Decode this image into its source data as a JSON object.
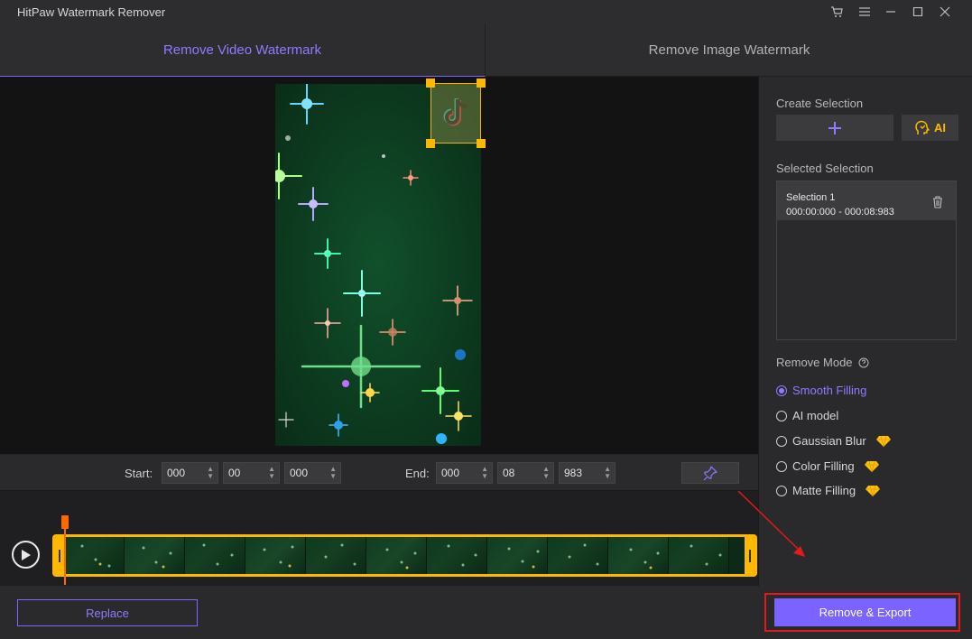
{
  "window": {
    "title": "HitPaw Watermark Remover",
    "controls": [
      "cart-icon",
      "menu-icon",
      "minimize-icon",
      "maximize-icon",
      "close-icon"
    ]
  },
  "tabs": [
    {
      "label": "Remove Video Watermark",
      "active": true
    },
    {
      "label": "Remove Image Watermark",
      "active": false
    }
  ],
  "time": {
    "start_label": "Start:",
    "start": {
      "h": "000",
      "m": "00",
      "s": "000"
    },
    "end_label": "End:",
    "end": {
      "h": "000",
      "m": "08",
      "s": "983"
    }
  },
  "panel": {
    "create_label": "Create Selection",
    "ai_label": "AI",
    "selected_label": "Selected Selection",
    "selections": [
      {
        "name": "Selection 1",
        "range": "000:00:000 - 000:08:983"
      }
    ],
    "mode_label": "Remove Mode",
    "modes": [
      {
        "label": "Smooth Filling",
        "selected": true,
        "premium": false
      },
      {
        "label": "AI model",
        "selected": false,
        "premium": false
      },
      {
        "label": "Gaussian Blur",
        "selected": false,
        "premium": true
      },
      {
        "label": "Color Filling",
        "selected": false,
        "premium": true
      },
      {
        "label": "Matte Filling",
        "selected": false,
        "premium": true
      }
    ]
  },
  "footer": {
    "replace_label": "Replace",
    "export_label": "Remove & Export"
  },
  "colors": {
    "accent": "#7b63ff",
    "highlight": "#ffb800",
    "annotation": "#e11a1a",
    "playhead": "#ff6a00"
  }
}
